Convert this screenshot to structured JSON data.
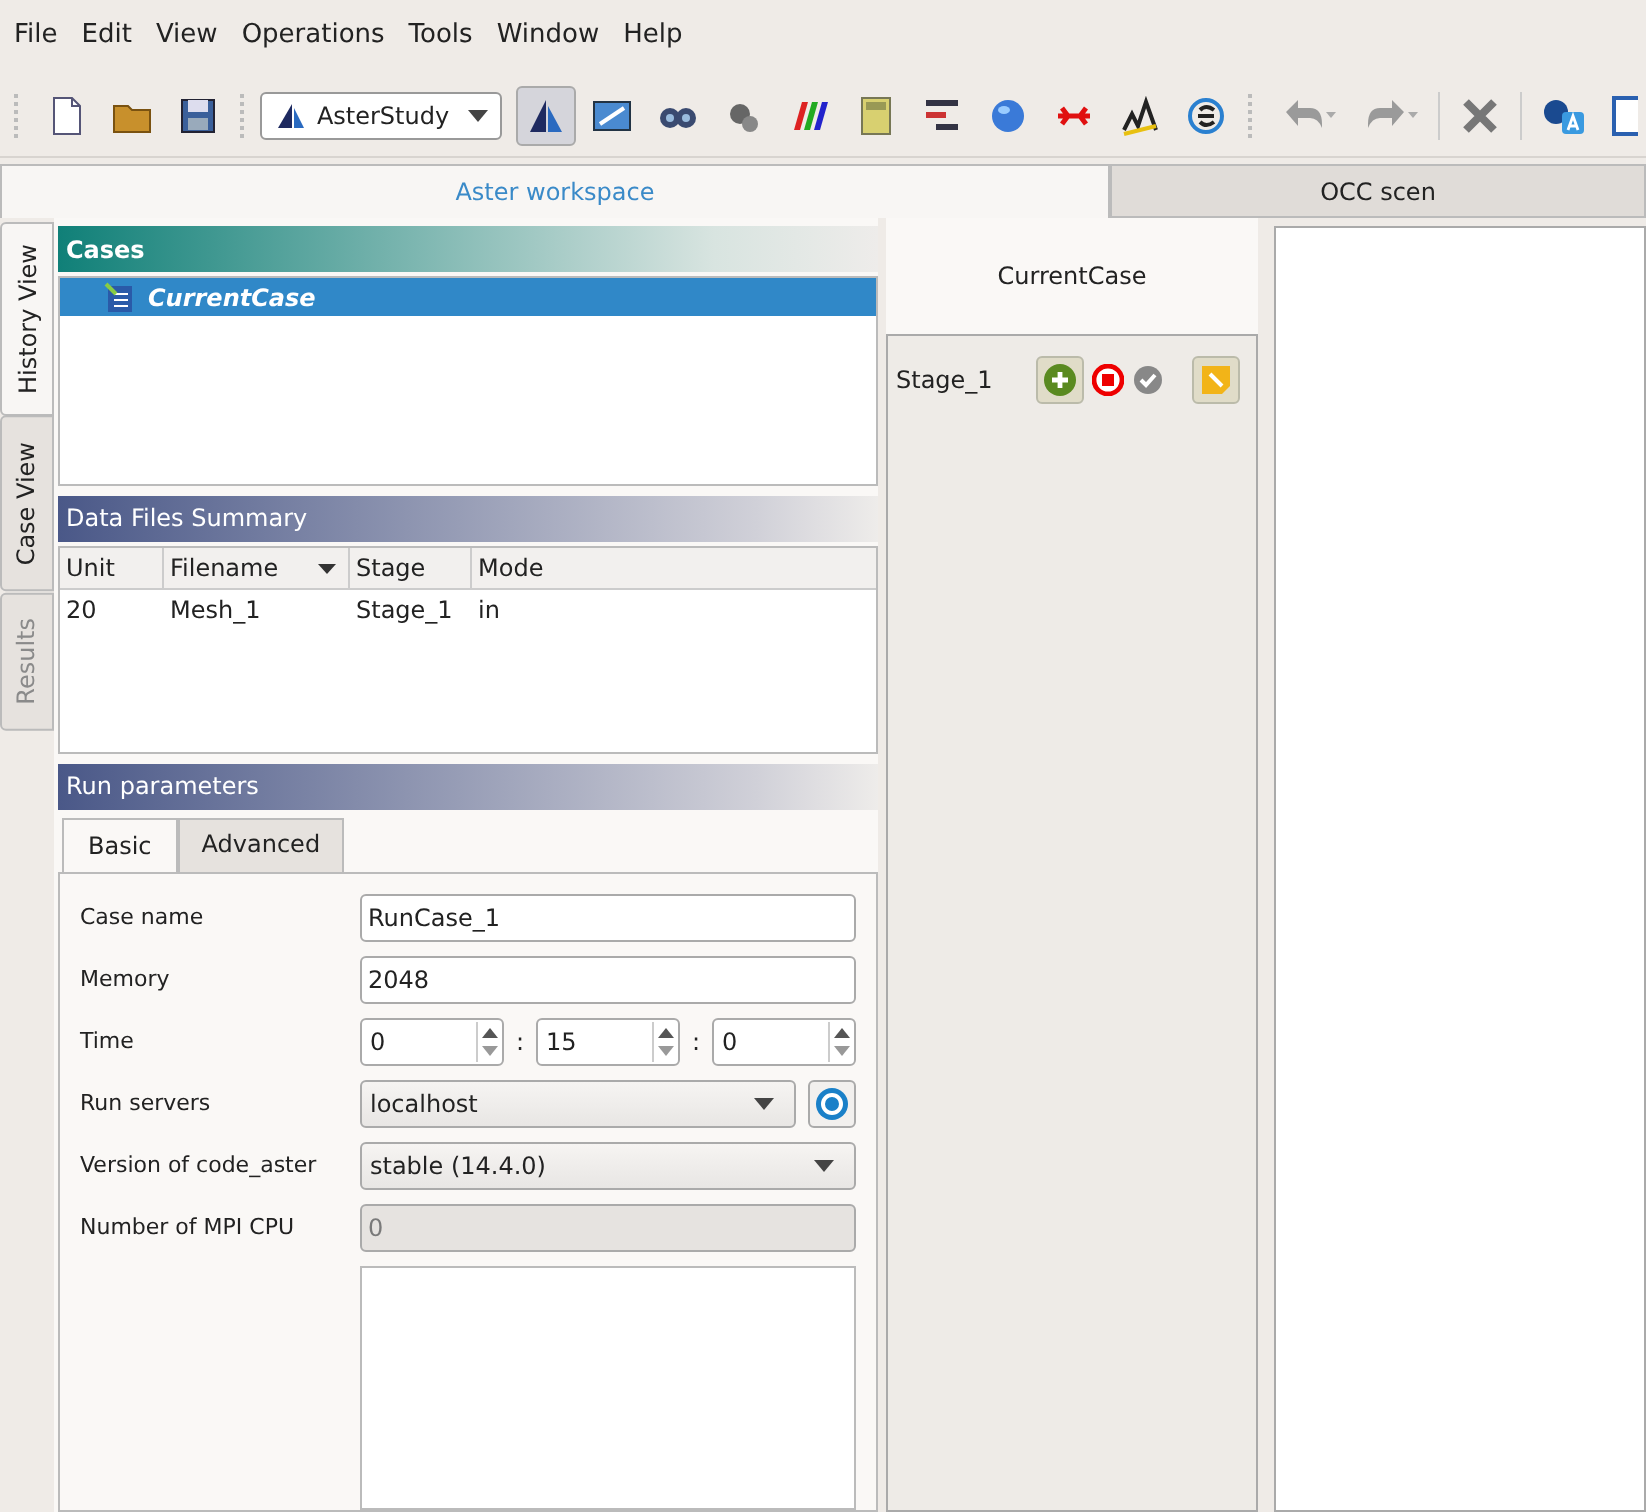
{
  "menu": [
    {
      "label": "File"
    },
    {
      "label": "Edit"
    },
    {
      "label": "View"
    },
    {
      "label": "Operations"
    },
    {
      "label": "Tools"
    },
    {
      "label": "Window"
    },
    {
      "label": "Help"
    }
  ],
  "toolbar": {
    "module_selector": "AsterStudy"
  },
  "workspace_tabs": [
    {
      "label": "Aster workspace",
      "selected": true
    },
    {
      "label": "OCC scen",
      "selected": false
    }
  ],
  "side_tabs": [
    {
      "label": "History View",
      "selected": true,
      "disabled": false
    },
    {
      "label": "Case View",
      "selected": false,
      "disabled": false
    },
    {
      "label": "Results",
      "selected": false,
      "disabled": true
    }
  ],
  "cases": {
    "title": "Cases",
    "items": [
      {
        "label": "CurrentCase",
        "selected": true
      }
    ]
  },
  "data_files": {
    "title": "Data Files Summary",
    "columns": [
      "Unit",
      "Filename",
      "Stage",
      "Mode"
    ],
    "rows": [
      [
        "20",
        "Mesh_1",
        "Stage_1",
        "in"
      ]
    ]
  },
  "run_parameters": {
    "title": "Run parameters",
    "tabs": [
      {
        "label": "Basic",
        "selected": true
      },
      {
        "label": "Advanced",
        "selected": false
      }
    ],
    "fields": [
      {
        "kind": "text",
        "label": "Case name",
        "value": "RunCase_1"
      },
      {
        "kind": "text",
        "label": "Memory",
        "value": "2048"
      },
      {
        "kind": "time",
        "label": "Time",
        "values": [
          "0",
          "15",
          "0"
        ],
        "separators": [
          ":",
          ":"
        ]
      },
      {
        "kind": "combo_refresh",
        "label": "Run servers",
        "value": "localhost"
      },
      {
        "kind": "combo",
        "label": "Version of code_aster",
        "value": "stable (14.4.0)"
      },
      {
        "kind": "disabled",
        "label": "Number of MPI CPU",
        "value": "0"
      },
      {
        "kind": "textarea"
      }
    ]
  },
  "case_pane": {
    "title": "CurrentCase",
    "stages": [
      {
        "label": "Stage_1"
      }
    ]
  }
}
